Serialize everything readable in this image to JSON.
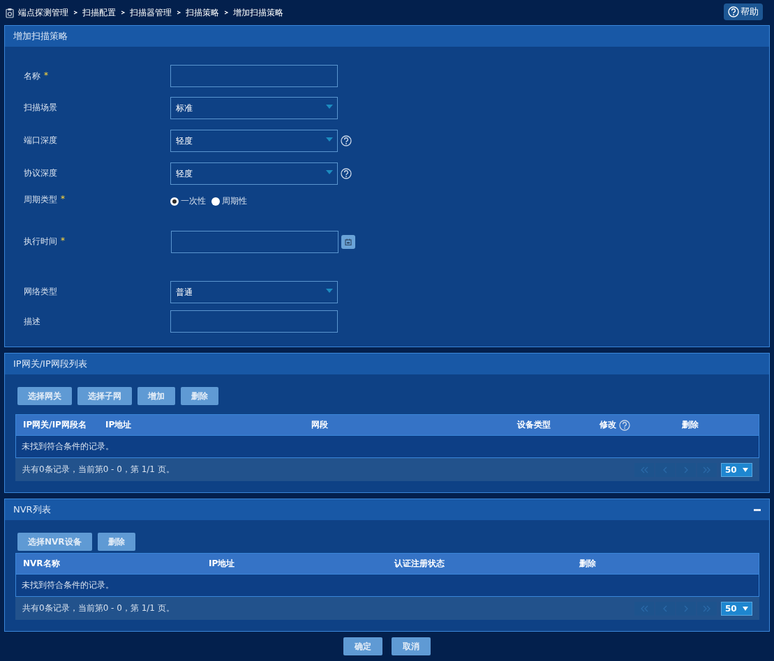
{
  "breadcrumb": [
    "端点探测管理",
    "扫描配置",
    "扫描器管理",
    "扫描策略",
    "增加扫描策略"
  ],
  "help_button": {
    "label": "帮助"
  },
  "form_panel": {
    "title": "增加扫描策略",
    "fields": [
      {
        "kind": "text",
        "label": "名称",
        "required_mark": "*",
        "help": false
      },
      {
        "kind": "select",
        "label": "扫描场景",
        "value": "标准",
        "help": false
      },
      {
        "kind": "select",
        "label": "端口深度",
        "value": "轻度",
        "help": true
      },
      {
        "kind": "select",
        "label": "协议深度",
        "value": "轻度",
        "help": true
      },
      {
        "kind": "radio",
        "label": "周期类型",
        "required_mark": "*",
        "options": [
          {
            "label": "一次性",
            "selected": true
          },
          {
            "label": "周期性",
            "selected": false
          }
        ]
      },
      {
        "kind": "date",
        "label": "执行时间",
        "required_mark": "*"
      },
      {
        "kind": "select",
        "label": "网络类型",
        "value": "普通",
        "help": false
      },
      {
        "kind": "text",
        "label": "描述",
        "help": false
      }
    ]
  },
  "ip_panel": {
    "title": "IP网关/IP网段列表",
    "collapsible": false,
    "buttons": [
      "选择网关",
      "选择子网",
      "增加",
      "删除"
    ],
    "table": {
      "columns": [
        {
          "label": "IP网关/IP网段名",
          "help": false
        },
        {
          "label": "IP地址",
          "help": false
        },
        {
          "label": "网段",
          "help": false
        },
        {
          "label": "设备类型",
          "help": false
        },
        {
          "label": "修改",
          "help": true
        },
        {
          "label": "删除",
          "help": false
        }
      ],
      "empty": "未找到符合条件的记录。"
    },
    "footer": "共有0条记录，当前第0 - 0，第 1/1 页。",
    "page_size": "50"
  },
  "nvr_panel": {
    "title": "NVR列表",
    "collapsible": true,
    "buttons": [
      "选择NVR设备",
      "删除"
    ],
    "table": {
      "columns": [
        {
          "label": "NVR名称",
          "help": false
        },
        {
          "label": "IP地址",
          "help": false
        },
        {
          "label": "认证注册状态",
          "help": false
        },
        {
          "label": "删除",
          "help": false
        }
      ],
      "empty": "未找到符合条件的记录。"
    },
    "footer": "共有0条记录，当前第0 - 0，第 1/1 页。",
    "page_size": "50"
  },
  "actions": [
    "确定",
    "取消"
  ]
}
